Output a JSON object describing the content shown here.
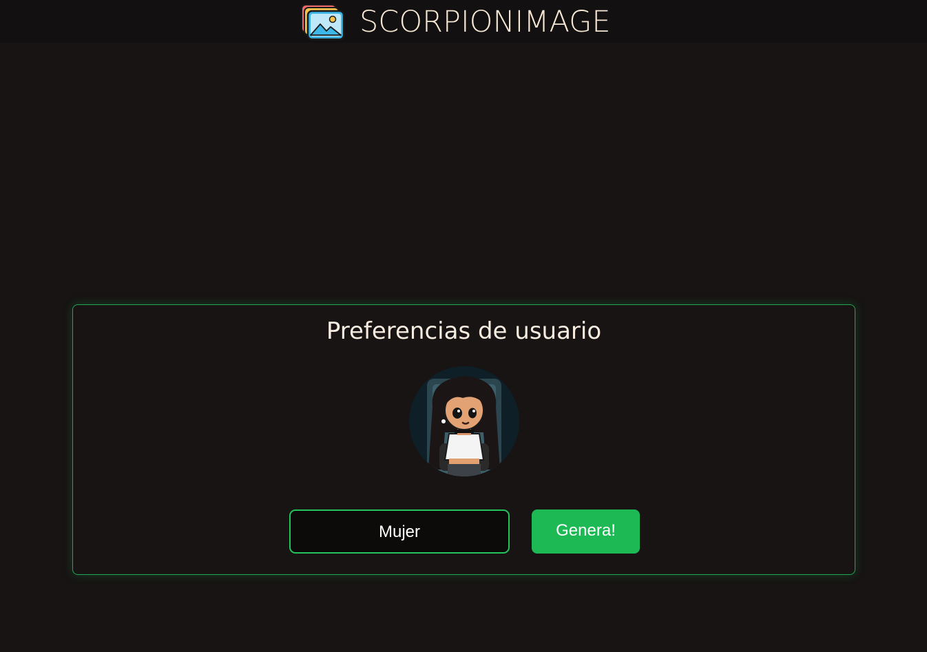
{
  "header": {
    "brand_name": "SCORPIONIMAGE",
    "logo_icon": "stacked-images-icon"
  },
  "panel": {
    "title": "Preferencias de usuario",
    "avatar_icon": "user-avatar",
    "gender_select": {
      "value": "Mujer"
    },
    "generate_button_label": "Genera!"
  },
  "colors": {
    "background": "#171413",
    "header_background": "#121010",
    "accent_green": "#1db954",
    "border_green": "#22a853",
    "text_light": "#f5e7d4"
  }
}
